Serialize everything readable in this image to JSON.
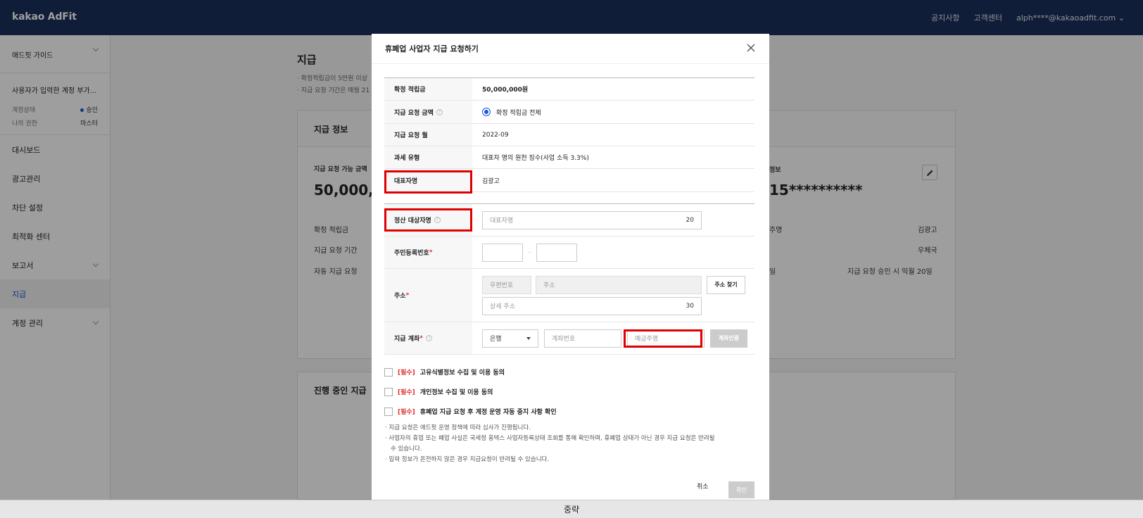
{
  "header": {
    "logo": "kakao AdFit",
    "nav": [
      "공지사항",
      "고객센터",
      "alph****@kakaoadfit.com"
    ]
  },
  "sidebar": {
    "guide": "애드핏 가이드",
    "account_name": "사용자가 입력한 계정 부가...",
    "status_label": "계정상태",
    "status_value": "승인",
    "role_label": "나의 권한",
    "role_value": "마스터",
    "menu": [
      {
        "label": "대시보드"
      },
      {
        "label": "광고관리"
      },
      {
        "label": "차단 설정"
      },
      {
        "label": "최적화 센터"
      },
      {
        "label": "보고서"
      },
      {
        "label": "지급"
      },
      {
        "label": "계정 관리"
      }
    ]
  },
  "background": {
    "page_title": "지급",
    "note1": "· 확정적립금이 5만원 이상",
    "note2": "· 지급 요청 기간은 매월 21",
    "card_title": "지급 정보",
    "available_label": "지급 요청 가능 금액",
    "available_value": "50,000,0",
    "row1": "확정 적립금",
    "row2": "지급 요청 기간",
    "row3": "자동 지급 요청",
    "right_label": "정보",
    "right_value": "15**********",
    "right_row1_label": "주명",
    "right_row1_value": "김광고",
    "right_row2_value": "우체국",
    "right_row3_label": "일",
    "right_row3_value": "지급 요청 승인 시 익월 20일",
    "progress_title": "진행 중인 지급"
  },
  "modal": {
    "title": "휴폐업 사업자 지급 요청하기",
    "rows": {
      "confirmed_label": "확정 적립금",
      "confirmed_value": "50,000,000원",
      "amount_label": "지급 요청 금액",
      "amount_value": "확정 적립금 전체",
      "month_label": "지급 요청 월",
      "month_value": "2022-09",
      "tax_label": "과세 유형",
      "tax_value": "대표자 명의 원천 징수(사업 소득 3.3%)",
      "rep_label": "대표자명",
      "rep_value": "김광고",
      "target_label": "정산 대상자명",
      "target_placeholder": "대표자명",
      "target_count": "20",
      "rrn_label": "주민등록번호",
      "rrn_sep": "-",
      "address_label": "주소",
      "zip_placeholder": "우편번호",
      "addr_placeholder": "주소",
      "find_address": "주소 찾기",
      "detail_placeholder": "상세 주소",
      "detail_count": "30",
      "account_label": "지급 계좌",
      "bank_value": "은행",
      "account_placeholder": "계좌번호",
      "holder_placeholder": "예금주명",
      "verify_button": "계좌인증",
      "required_mark": "*",
      "help_mark": "?"
    },
    "agreements": [
      {
        "tag": "[필수]",
        "text": "고유식별정보 수집 및 이용 동의"
      },
      {
        "tag": "[필수]",
        "text": "개인정보 수집 및 이용 동의"
      },
      {
        "tag": "[필수]",
        "text": "휴폐업 지급 요청 후 계정 운영 자동 중지 사항 확인"
      }
    ],
    "notes": [
      "· 지급 요청은 애드핏 운영 정책에 따라 심사가 진행됩니다.",
      "· 사업자의 휴업 또는 폐업 사실은 국세청 홈텍스 사업자등록상태 조회를 통해 확인하며, 휴폐업 상태가 아닌 경우 지급 요청은 반려될 수 있습니다.",
      "· 입력 정보가 온전하지 않은 경우 지급요청이 반려될 수 있습니다."
    ],
    "cancel": "취소",
    "confirm": "확인"
  },
  "footer": {
    "text": "중략"
  }
}
